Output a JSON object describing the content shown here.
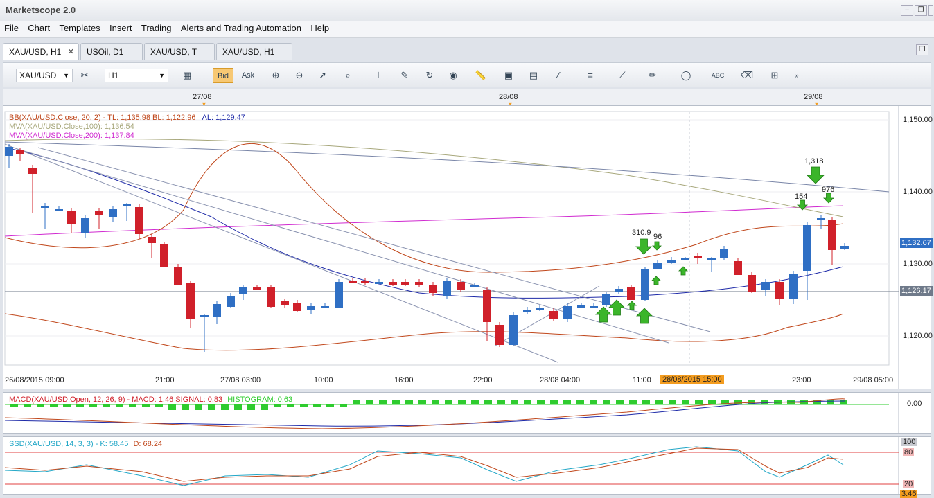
{
  "app": {
    "title": "Marketscope 2.0"
  },
  "menu": [
    "File",
    "Chart",
    "Templates",
    "Insert",
    "Trading",
    "Alerts and Trading Automation",
    "Help"
  ],
  "tabs": [
    {
      "label": "XAU/USD, H1",
      "active": true,
      "closable": true
    },
    {
      "label": "USOil, D1",
      "active": false,
      "closable": false
    },
    {
      "label": "XAU/USD, T",
      "active": false,
      "closable": false
    },
    {
      "label": "XAU/USD, H1",
      "active": false,
      "closable": false
    }
  ],
  "toolbar": {
    "instrument": "XAU/USD",
    "timeframe": "H1",
    "bid_label": "Bid",
    "ask_label": "Ask"
  },
  "top_dates": [
    "27/08",
    "28/08",
    "29/08"
  ],
  "main_chart": {
    "legends": [
      {
        "text": "BB(XAU/USD.Close, 20, 2) -  TL: 1,135.98  BL: 1,122.96",
        "color": "#c0471b"
      },
      {
        "text": "AL: 1,129.47",
        "color": "#1e2aa8"
      },
      {
        "text": "MVA(XAU/USD.Close,100): 1,136.54",
        "color": "#a7a77b"
      },
      {
        "text": "MVA(XAU/USD.Close,200): 1,137.84",
        "color": "#d02ad0"
      }
    ],
    "price_ticks": [
      "1,150.00",
      "1,140.00",
      "1,130.00",
      "1,120.00"
    ],
    "price_tags": [
      {
        "text": "1,132.67",
        "color": "#2f6fc4"
      },
      {
        "text": "1,126.17",
        "color": "#6f7a8a"
      }
    ],
    "time_ticks": [
      "26/08/2015 09:00",
      "21:00",
      "27/08 03:00",
      "10:00",
      "16:00",
      "22:00",
      "28/08 04:00",
      "11:00",
      "28/08/2015 15:00",
      "23:00",
      "29/08 05:00"
    ],
    "annotations": [
      "1,318",
      "976",
      "154",
      "310.9",
      "96"
    ]
  },
  "macd_panel": {
    "legend_macd": "MACD(XAU/USD.Open, 12, 26, 9) -  MACD: 1.46  SIGNAL: 0.83",
    "legend_hist": "HISTOGRAM: 0.63",
    "tick": "0.00"
  },
  "ssd_panel": {
    "legend_ssd": "SSD(XAU/USD, 14, 3, 3) -  K: 58.45",
    "legend_d": "D: 68.24",
    "ticks": [
      "100",
      "80",
      "20",
      "3.46"
    ]
  },
  "colors": {
    "bull": "#2f6fc4",
    "bear": "#d0202a",
    "accent": "#f39c1f"
  }
}
